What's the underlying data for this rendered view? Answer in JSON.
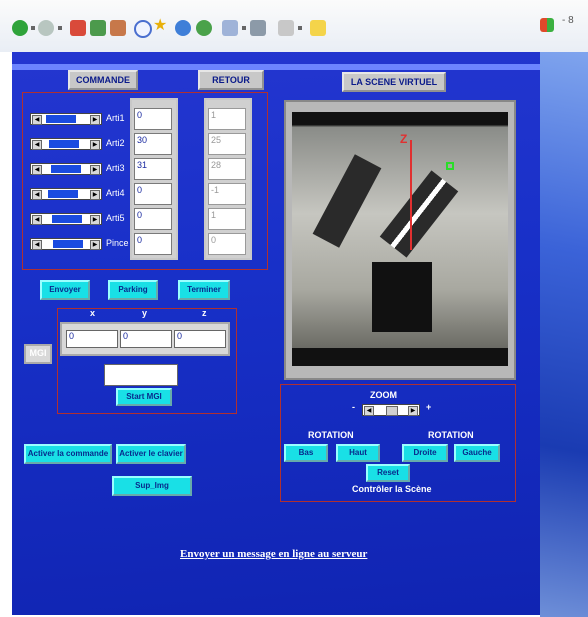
{
  "panels": {
    "commande": "COMMANDE",
    "retour": "RETOUR",
    "scene": "LA SCENE VIRTUEL"
  },
  "joints": [
    {
      "label": "Arti1",
      "command": "0",
      "feedback": "1",
      "position": 0.15
    },
    {
      "label": "Arti2",
      "command": "30",
      "feedback": "25",
      "position": 0.32
    },
    {
      "label": "Arti3",
      "command": "31",
      "feedback": "28",
      "position": 0.45
    },
    {
      "label": "Arti4",
      "command": "0",
      "feedback": "-1",
      "position": 0.3
    },
    {
      "label": "Arti5",
      "command": "0",
      "feedback": "1",
      "position": 0.5
    },
    {
      "label": "Pince",
      "command": "0",
      "feedback": "0",
      "position": 0.55
    }
  ],
  "buttons": {
    "envoyer": "Envoyer",
    "parking": "Parking",
    "terminer": "Terminer",
    "start_mgi": "Start MGI",
    "activer_commande": "Activer la commande",
    "activer_clavier": "Activer le clavier",
    "sup_img": "Sup_Img",
    "bas": "Bas",
    "haut": "Haut",
    "droite": "Droite",
    "gauche": "Gauche",
    "reset": "Reset"
  },
  "mgi": {
    "label": "MGI",
    "x_label": "x",
    "y_label": "y",
    "z_label": "z",
    "x": "0",
    "y": "0",
    "z": "0",
    "result": ""
  },
  "scene_controls": {
    "zoom": "ZOOM",
    "minus": "-",
    "plus": "+",
    "rotation_left": "ROTATION",
    "rotation_right": "ROTATION",
    "caption": "Contrôler la Scène",
    "zoom_level": 0.45,
    "axis_label": "Z"
  },
  "link": "Envoyer un message en ligne au serveur",
  "toolbar": {
    "icons": [
      "back-icon",
      "forward-icon",
      "stop-icon",
      "refresh-icon",
      "home-icon",
      "search-icon",
      "favorites-icon",
      "media-icon",
      "history-icon",
      "mail-icon",
      "print-icon",
      "edit-icon",
      "notes-icon"
    ],
    "windows_flag_text": "- 8"
  },
  "colors": {
    "panel_blue": "#1830c8",
    "button_cyan": "#19e0e6",
    "frame_red": "#b03030"
  }
}
